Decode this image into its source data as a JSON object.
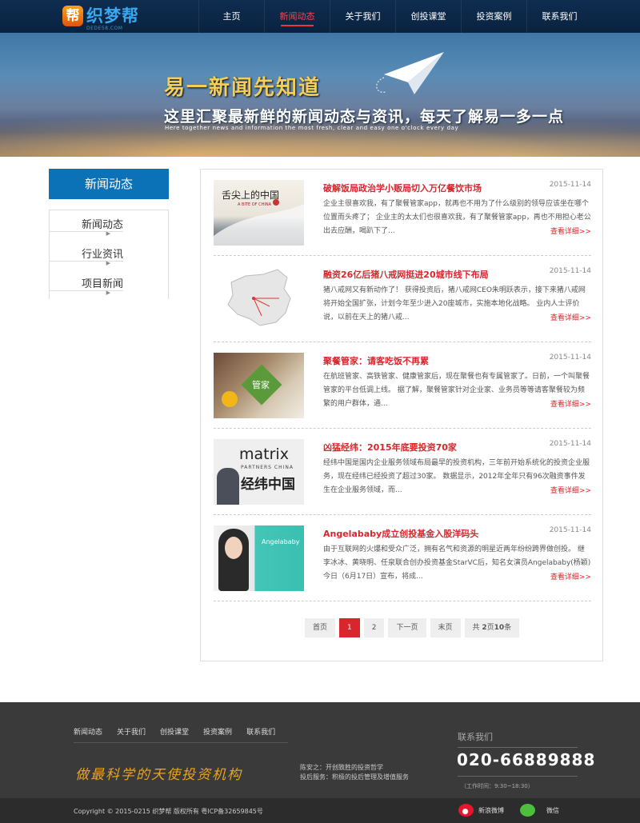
{
  "header": {
    "logo_badge": "帮",
    "logo_text": "织梦帮",
    "logo_sub": "DEDE58.COM",
    "nav": [
      "主页",
      "新闻动态",
      "关于我们",
      "创投课堂",
      "投资案例",
      "联系我们"
    ]
  },
  "banner": {
    "title": "易一新闻先知道",
    "subtitle": "这里汇聚最新鲜的新闻动态与资讯，每天了解易一多一点",
    "english": "Here together news and information the most fresh, clear and easy one o'clock every day"
  },
  "sidebar": {
    "heading": "新闻动态",
    "items": [
      "新闻动态",
      "行业资讯",
      "项目新闻"
    ],
    "arrow": "▶"
  },
  "news": [
    {
      "title": "破解饭局政治学小贩局切入万亿餐饮市场",
      "date": "2015-11-14",
      "body": "企业主很喜欢我，有了聚餐管家app，就再也不用为了什么级别的领导应该坐在哪个位置而头疼了； 企业主的太太们也很喜欢我，有了聚餐管家app，再也不用担心老公出去应酬，喝趴下了...",
      "more": "查看详细>>",
      "thumb_text": "舌尖上的中国"
    },
    {
      "title": "融资26亿后猪八戒网挺进20城市线下布局",
      "date": "2015-11-14",
      "body": "猪八戒网又有新动作了！ 获得投资后，猪八戒网CEO朱明跃表示，接下来猪八戒网将开始全国扩张，计划今年至少进入20座城市，实施本地化战略。 业内人士评价说，以前在天上的猪八戒...",
      "more": "查看详细>>",
      "thumb_text": ""
    },
    {
      "title": "聚餐管家：请客吃饭不再累",
      "date": "2015-11-14",
      "body": "在航班管家、高铁管家、健康管家后，现在聚餐也有专属管家了。日前，一个叫聚餐管家的平台低调上线。 据了解，聚餐管家针对企业家、业务员等等请客聚餐较为频繁的用户群体，通...",
      "more": "查看详细>>",
      "thumb_text": "管家"
    },
    {
      "title": "凶猛经纬：2015年底要投资70家",
      "date": "2015-11-14",
      "body": "经纬中国是国内企业服务领域布局最早的投资机构，三年前开始系统化的投资企业服务，现在经纬已经投资了超过30家。 数据显示，2012年全年只有96次融资事件发生在企业服务领域，而...",
      "more": "查看详细>>",
      "thumb_text": "matrix"
    },
    {
      "title": "Angelababy成立创投基金入股洋码头",
      "date": "2015-11-14",
      "body": "由于互联网的火爆和受众广泛，拥有名气和资源的明星近两年纷纷跨界做创投。 继李冰冰、黄晓明、任泉联合创办投资基金StarVC后，知名女演员Angelababy(杨颖)今日（6月17日）宣布，将成...",
      "more": "查看详细>>",
      "thumb_text": "Angelababy"
    }
  ],
  "thumb_extra": {
    "matrix_sub": "PARTNERS CHINA",
    "matrix_cn": "经纬中国",
    "food_sub": "A BITE OF CHINA"
  },
  "pager": {
    "first": "首页",
    "p1": "1",
    "p2": "2",
    "next": "下一页",
    "last": "末页",
    "total_prefix": "共 ",
    "pages": "2",
    "pages_unit": "页",
    "count": "10",
    "count_unit": "条"
  },
  "footer": {
    "nav": [
      "新闻动态",
      "关于我们",
      "创投课堂",
      "投资案例",
      "联系我们"
    ],
    "slogan": "做最科学的天使投资机构",
    "line1": "陈安之：开创致胜的投资哲学",
    "line2": "投后服务：积极的投后管理及增值服务",
    "contact_label": "联系我们",
    "phone": "020-66889888",
    "hours": "（工作时间：9:30~18:30）",
    "copyright": "Copyright © 2015-0215 织梦帮 版权所有 粤ICP备32659845号",
    "weibo": "新浪微博",
    "weixin": "微信"
  },
  "colors": {
    "accent_red": "#d8262c",
    "brand_blue": "#0b72b8",
    "header_bg": "#0e2d50"
  }
}
